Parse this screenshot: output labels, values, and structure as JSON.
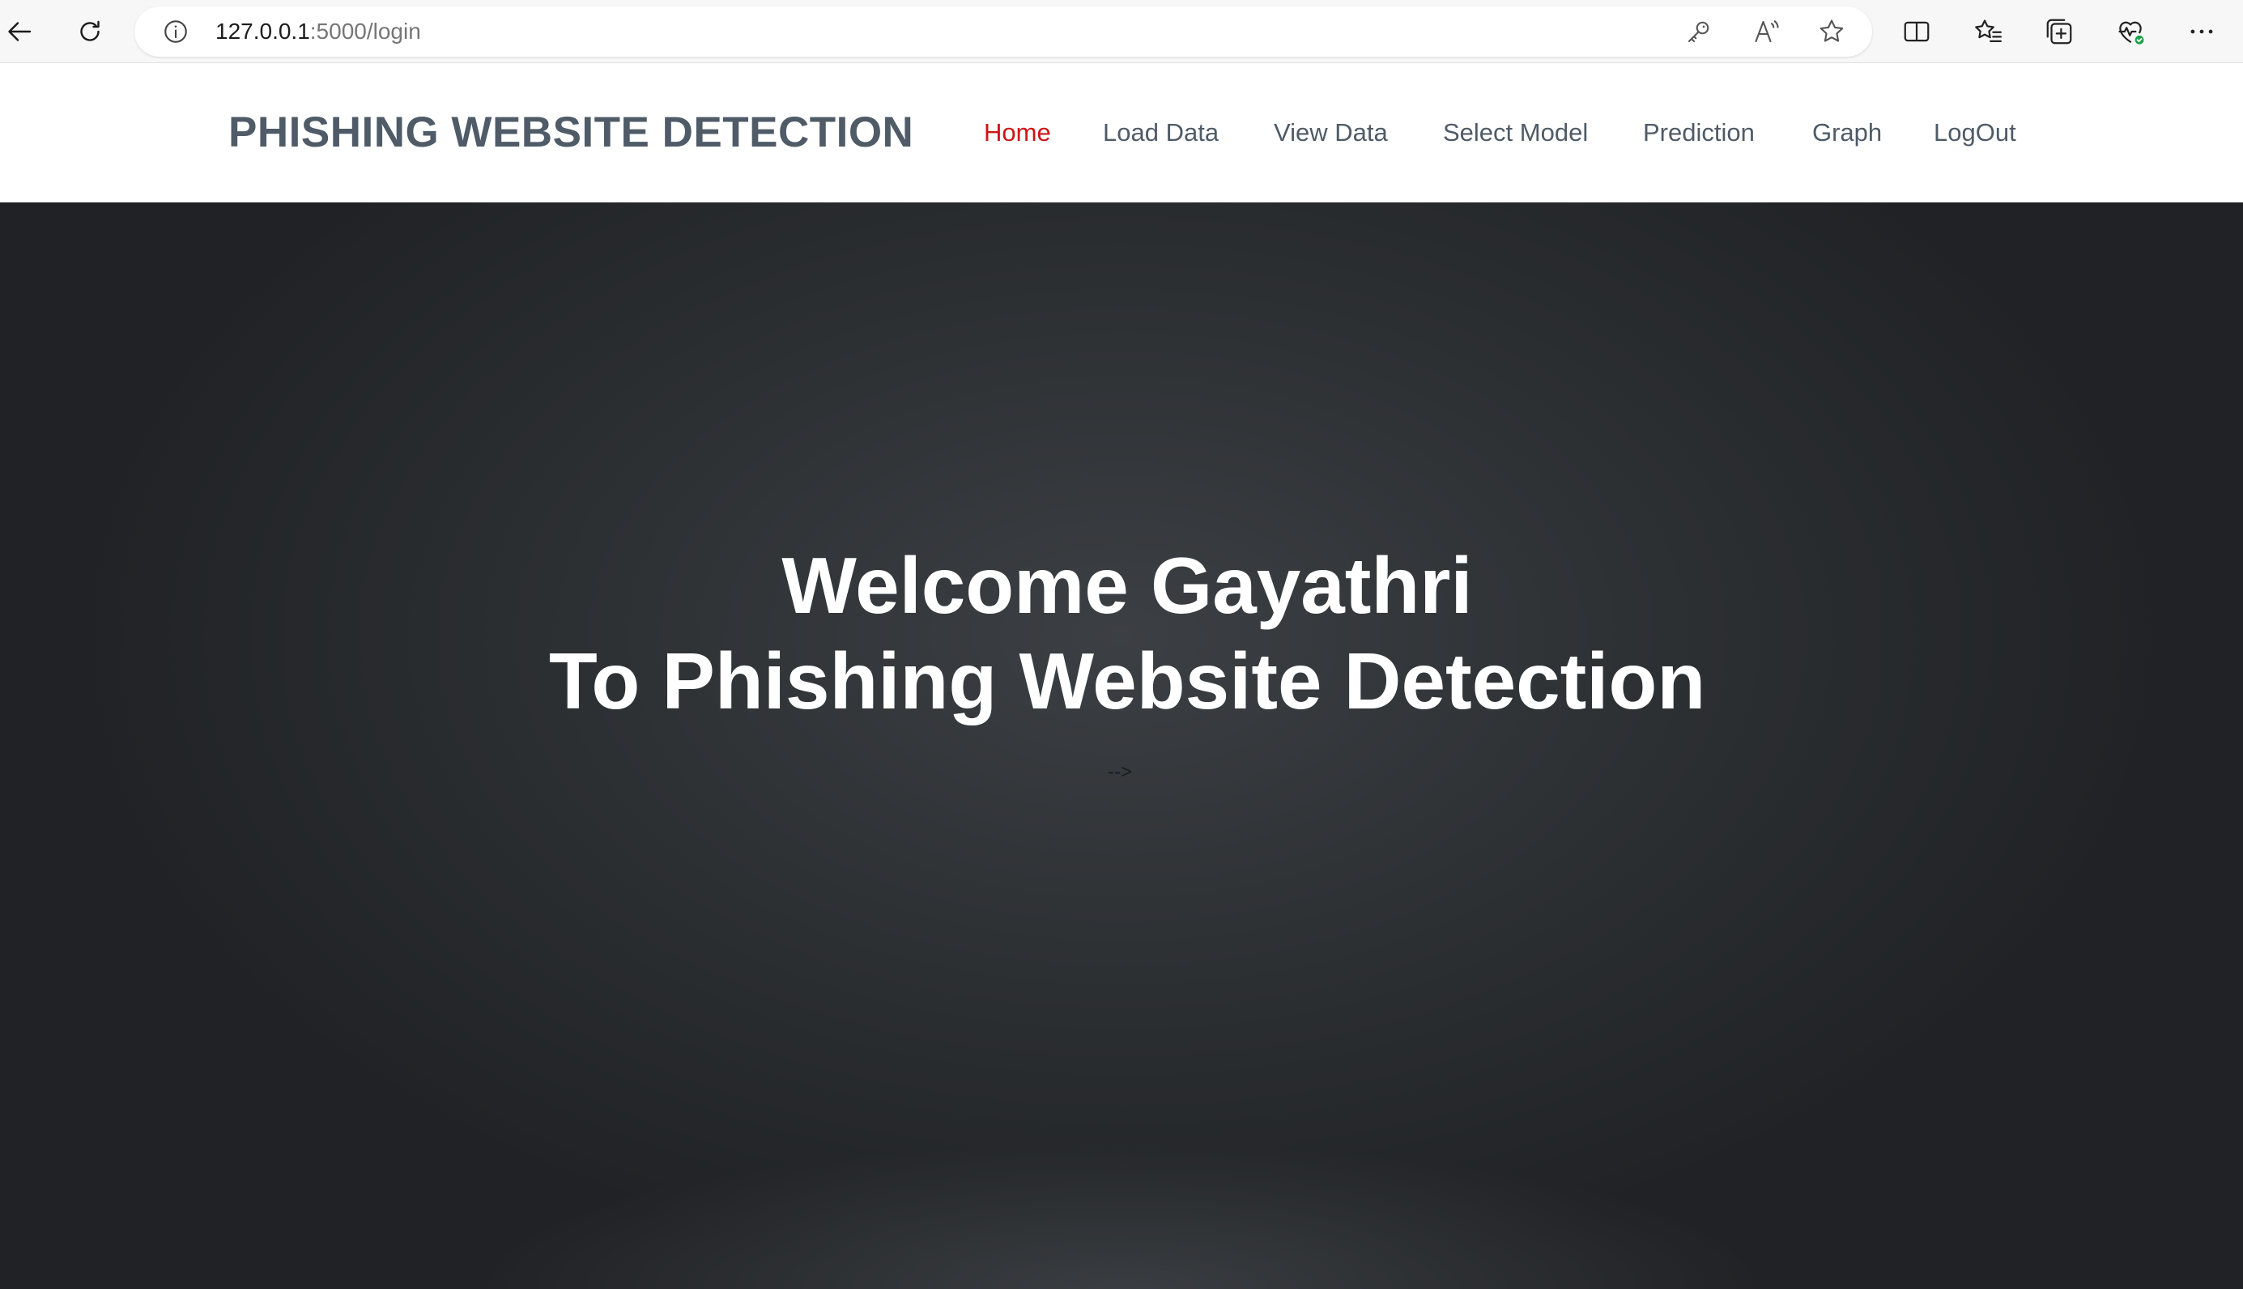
{
  "browser": {
    "url_host": "127.0.0.1",
    "url_path": ":5000/login",
    "icons": {
      "back": "back-arrow-icon",
      "reload": "reload-icon",
      "site_info": "info-icon",
      "password": "key-icon",
      "read_aloud": "read-aloud-icon",
      "favorite": "star-icon",
      "split_screen": "split-screen-icon",
      "favorites": "favorites-icon",
      "collections": "collections-icon",
      "browser_essentials": "heart-pulse-icon",
      "more": "more-icon"
    }
  },
  "header": {
    "brand": "PHISHING WEBSITE DETECTION",
    "nav": [
      {
        "label": "Home",
        "active": true
      },
      {
        "label": "Load Data",
        "active": false
      },
      {
        "label": "View Data",
        "active": false
      },
      {
        "label": "Select Model",
        "active": false
      },
      {
        "label": "Prediction",
        "active": false
      },
      {
        "label": "Graph",
        "active": false
      },
      {
        "label": "LogOut",
        "active": false
      }
    ]
  },
  "hero": {
    "line1": "Welcome Gayathri",
    "line2": "To Phishing Website Detection",
    "stray_text": "-->"
  },
  "colors": {
    "brand_text": "#4f5b67",
    "nav_active": "#d01416",
    "hero_bg": "#2c2f32"
  }
}
